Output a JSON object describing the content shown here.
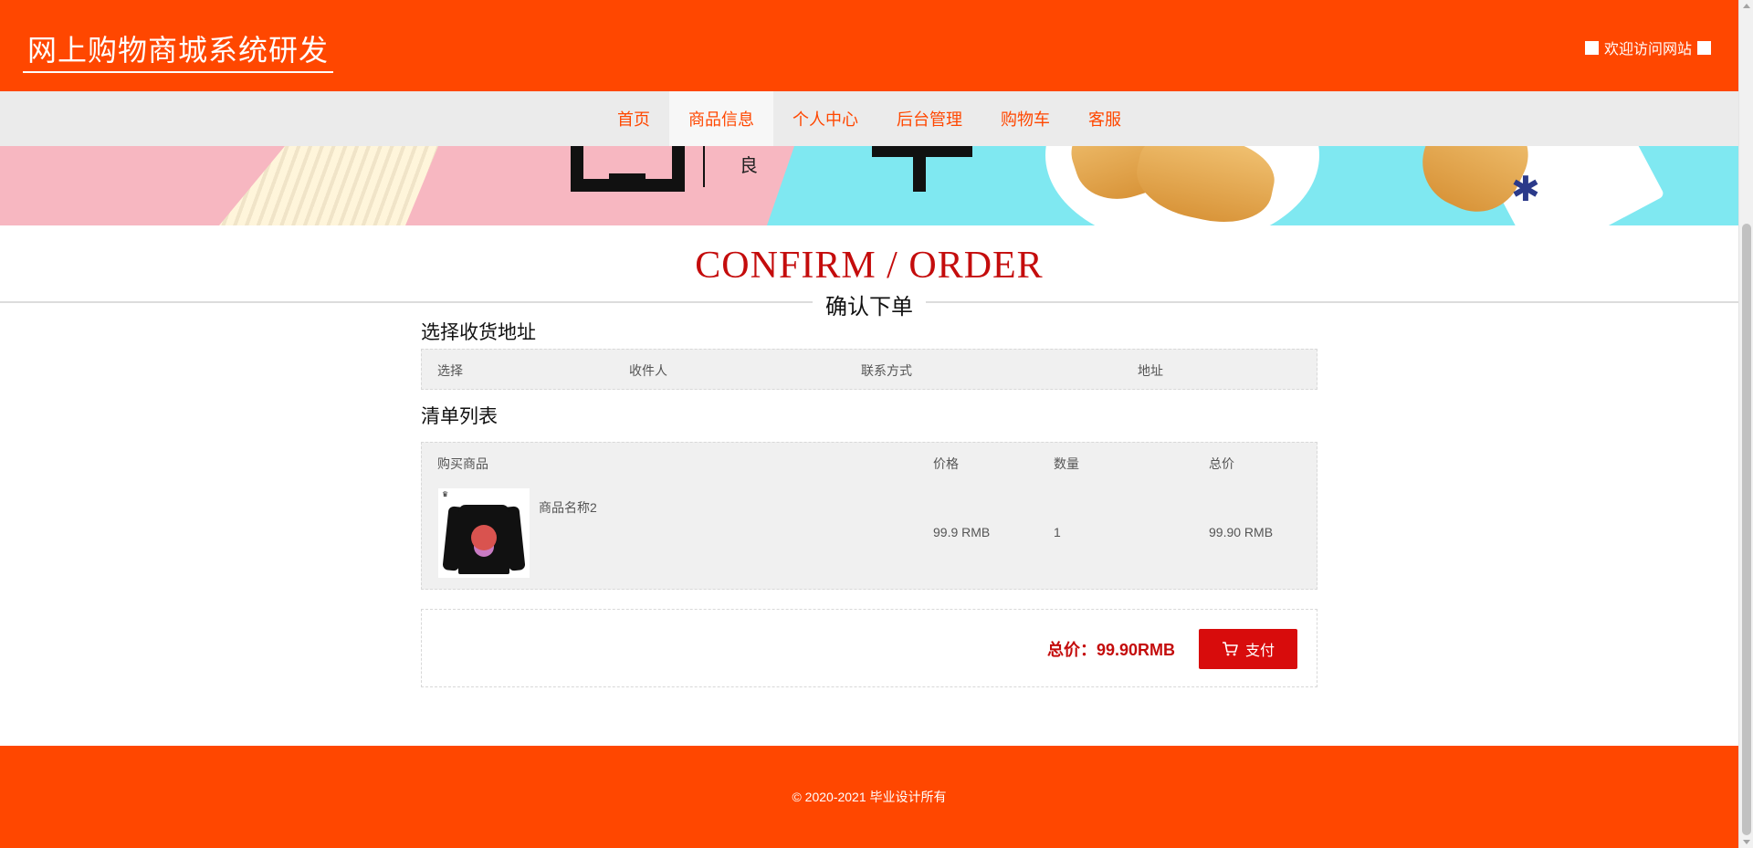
{
  "header": {
    "site_title": "网上购物商城系统研发",
    "welcome_text": "欢迎访问网站"
  },
  "nav": {
    "items": [
      {
        "label": "首页"
      },
      {
        "label": "商品信息"
      },
      {
        "label": "个人中心"
      },
      {
        "label": "后台管理"
      },
      {
        "label": "购物车"
      },
      {
        "label": "客服"
      }
    ],
    "active": "商品信息"
  },
  "page": {
    "title_en": "CONFIRM / ORDER",
    "title_cn": "确认下单"
  },
  "address_section": {
    "title": "选择收货地址",
    "columns": [
      "选择",
      "收件人",
      "联系方式",
      "地址"
    ]
  },
  "items_section": {
    "title": "清单列表",
    "columns": [
      "购买商品",
      "价格",
      "数量",
      "总价"
    ],
    "rows": [
      {
        "name": "商品名称2",
        "price": "99.9 RMB",
        "quantity": "1",
        "total": "99.90 RMB",
        "thumb_icon": "black-tshirt-image"
      }
    ]
  },
  "summary": {
    "total_label": "总价：99.90RMB",
    "pay_label": "支付",
    "pay_icon": "cart-icon"
  },
  "footer": {
    "copyright": "© 2020-2021 毕业设计所有"
  },
  "colors": {
    "brand": "#ff4700",
    "accent_red": "#c40c0c",
    "button_red": "#d80c0c",
    "nav_bg": "#ebebeb",
    "table_bg": "#f0f0f0"
  }
}
